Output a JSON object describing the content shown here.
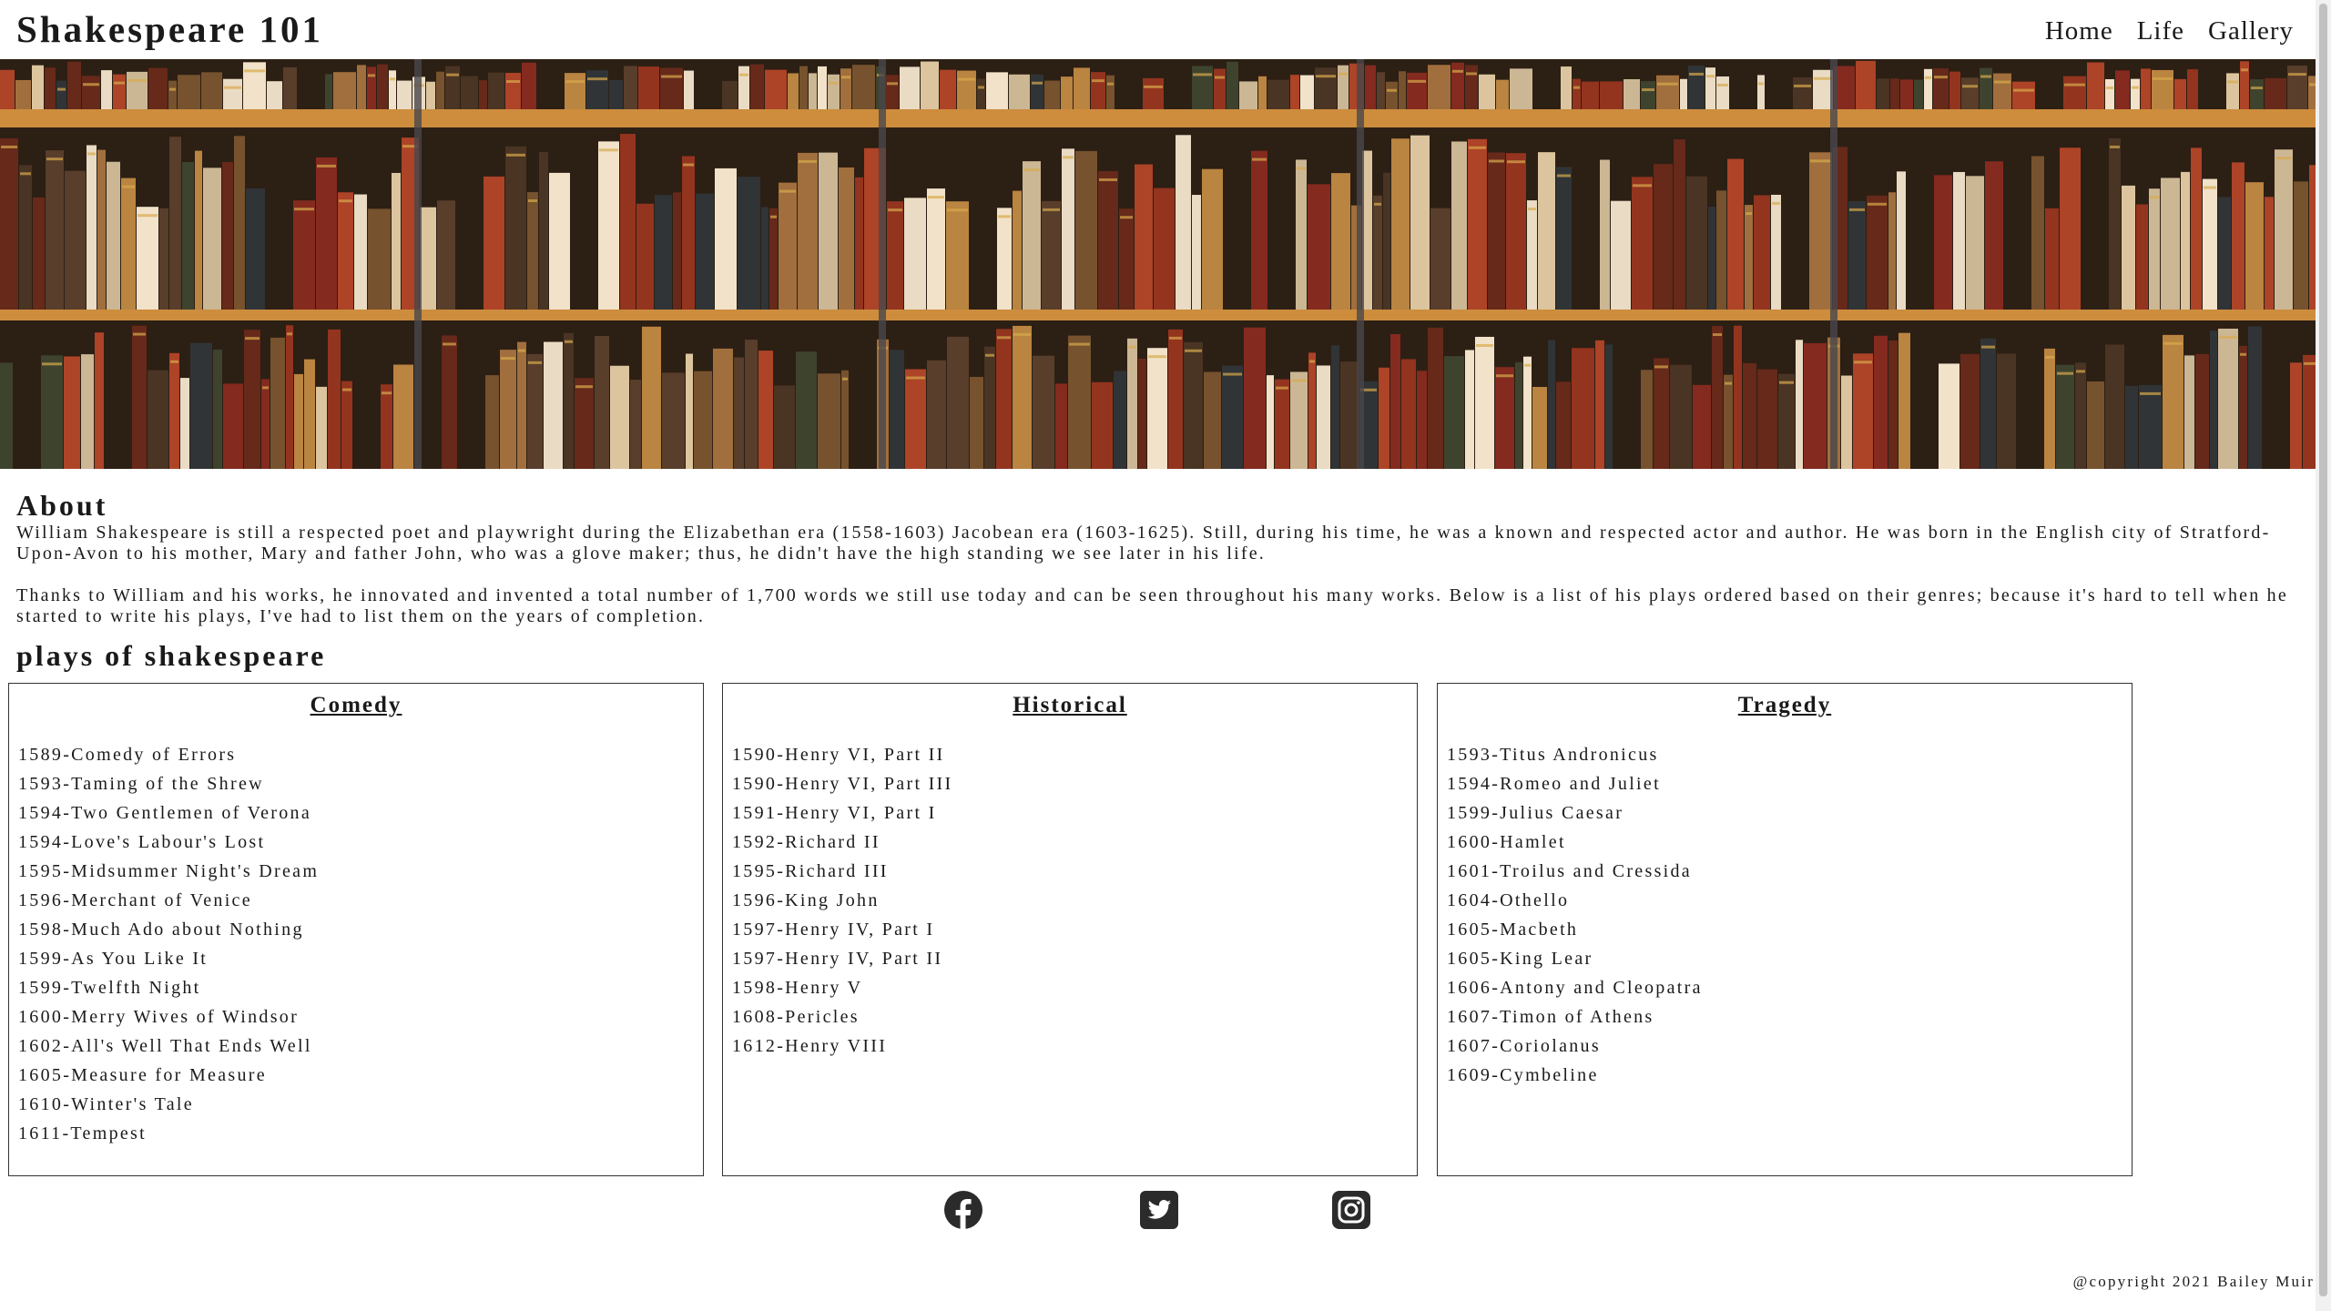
{
  "header": {
    "title": "Shakespeare 101",
    "nav": [
      "Home",
      "Life",
      "Gallery"
    ]
  },
  "about": {
    "heading": "About",
    "paragraphs": [
      "William Shakespeare is still a respected poet and playwright during the Elizabethan era (1558-1603) Jacobean era (1603-1625). Still, during his time, he was a known and respected actor and author. He was born in the English city of Stratford-Upon-Avon to his mother, Mary and father John, who was a glove maker; thus, he didn't have the high standing we see later in his life.",
      "Thanks to William and his works, he innovated and invented a total number of 1,700 words we still use today and can be seen throughout his many works. Below is a list of his plays ordered based on their genres; because it's hard to tell when he started to write his plays, I've had to list them on the years of completion."
    ]
  },
  "plays": {
    "heading": "plays of shakespeare",
    "comedy": {
      "title": "Comedy",
      "items": [
        "1589-Comedy of Errors",
        "1593-Taming of the Shrew",
        "1594-Two Gentlemen of Verona",
        "1594-Love's Labour's Lost",
        "1595-Midsummer Night's Dream",
        "1596-Merchant of Venice",
        "1598-Much Ado about Nothing",
        "1599-As You Like It",
        "1599-Twelfth Night",
        "1600-Merry Wives of Windsor",
        "1602-All's Well That Ends Well",
        "1605-Measure for Measure",
        "1610-Winter's Tale",
        "1611-Tempest"
      ]
    },
    "historical": {
      "title": "Historical",
      "items": [
        "1590-Henry VI, Part II",
        "1590-Henry VI, Part III",
        "1591-Henry VI, Part I",
        "1592-Richard II",
        "1595-Richard III",
        "1596-King John",
        "1597-Henry IV, Part I",
        "1597-Henry IV, Part II",
        "1598-Henry V",
        "1608-Pericles",
        "1612-Henry VIII"
      ]
    },
    "tragedy": {
      "title": "Tragedy",
      "items": [
        "1593-Titus Andronicus",
        "1594-Romeo and Juliet",
        "1599-Julius Caesar",
        "1600-Hamlet",
        "1601-Troilus and Cressida",
        "1604-Othello",
        "1605-Macbeth",
        "1605-King Lear",
        "1606-Antony and Cleopatra",
        "1607-Timon of Athens",
        "1607-Coriolanus",
        "1609-Cymbeline"
      ]
    }
  },
  "social": [
    "facebook-icon",
    "twitter-icon",
    "instagram-icon"
  ],
  "footer": {
    "copyright": "@copyright 2021 Bailey Muir"
  }
}
